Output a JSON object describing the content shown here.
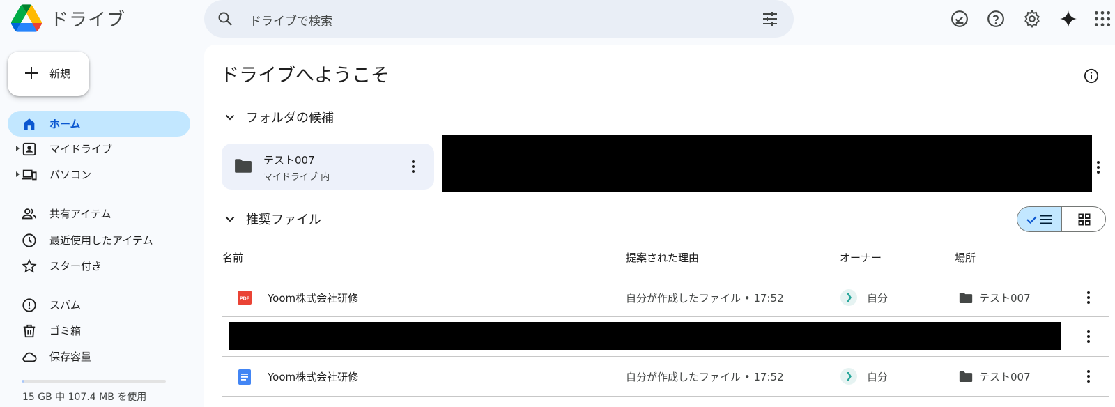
{
  "header": {
    "app_title": "ドライブ",
    "search_placeholder": "ドライブで検索",
    "icons": [
      "drive-logo",
      "search-icon",
      "filter-icon",
      "offline-check-icon",
      "help-icon",
      "settings-icon",
      "gemini-icon",
      "apps-grid-icon"
    ]
  },
  "sidebar": {
    "new_label": "新規",
    "items": [
      {
        "label": "ホーム",
        "icon": "home-icon",
        "active": true
      },
      {
        "label": "マイドライブ",
        "icon": "my-drive-icon",
        "expandable": true
      },
      {
        "label": "パソコン",
        "icon": "computers-icon",
        "expandable": true
      },
      {
        "label": "共有アイテム",
        "icon": "shared-icon"
      },
      {
        "label": "最近使用したアイテム",
        "icon": "recent-icon"
      },
      {
        "label": "スター付き",
        "icon": "star-icon"
      },
      {
        "label": "スパム",
        "icon": "spam-icon"
      },
      {
        "label": "ゴミ箱",
        "icon": "trash-icon"
      },
      {
        "label": "保存容量",
        "icon": "cloud-icon"
      }
    ],
    "storage_text": "15 GB 中 107.4 MB を使用",
    "storage_fraction": 0.007
  },
  "main": {
    "title": "ドライブへようこそ",
    "folders_section": "フォルダの候補",
    "folder": {
      "name": "テスト007",
      "location": "マイドライブ 内"
    },
    "files_section": "推奨ファイル",
    "columns": {
      "name": "名前",
      "reason": "提案された理由",
      "owner": "オーナー",
      "location": "場所"
    },
    "rows": [
      {
        "type": "pdf",
        "name": "Yoom株式会社研修",
        "reason": "自分が作成したファイル • 17:52",
        "owner": "自分",
        "location": "テスト007"
      },
      {
        "type": "redacted"
      },
      {
        "type": "doc",
        "name": "Yoom株式会社研修",
        "reason": "自分が作成したファイル • 17:52",
        "owner": "自分",
        "location": "テスト007"
      }
    ]
  },
  "colors": {
    "accent": "#0b57d0",
    "active_bg": "#c2e7ff",
    "pdf": "#ea4335",
    "doc": "#4285f4"
  }
}
